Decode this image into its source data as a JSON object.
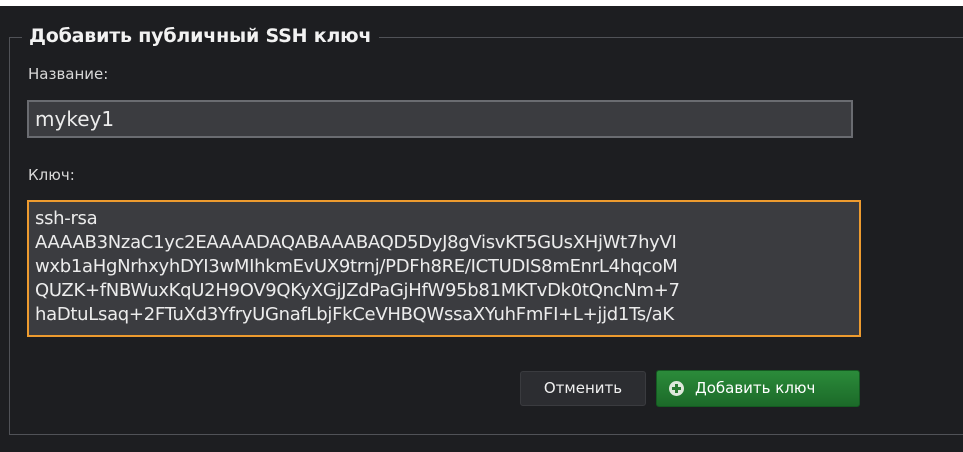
{
  "form": {
    "legend": "Добавить публичный SSH ключ",
    "name_label": "Название:",
    "name_value": "mykey1",
    "key_label": "Ключ:",
    "key_lines": [
      "ssh-rsa",
      "AAAAB3NzaC1yc2EAAAADAQABAAABAQD5DyJ8gVisvKT5GUsXHjWt7hyVI",
      "wxb1aHgNrhxyhDYI3wMIhkmEvUX9trnj/PDFh8RE/ICTUDIS8mEnrL4hqcoM",
      "QUZK+fNBWuxKqU2H9OV9QKyXGjJZdPaGjHfW95b81MKTvDk0tQncNm+7",
      "haDtuLsaq+2FTuXd3YfryUGnafLbjFkCeVHBQWssaXYuhFmFI+L+jjd1Ts/aK"
    ],
    "cancel_label": "Отменить",
    "add_label": "Добавить ключ"
  },
  "colors": {
    "panel_bg": "#1d1e21",
    "focus_border": "#ed9b2f",
    "primary_button": "#1c6a29"
  },
  "icons": {
    "add_button_icon": "plus-circle-icon"
  }
}
